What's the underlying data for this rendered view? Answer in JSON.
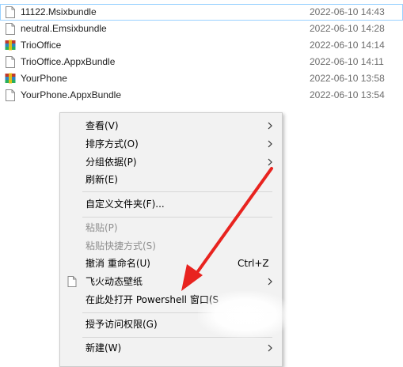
{
  "files": [
    {
      "name": "11122.Msixbundle",
      "date": "2022-06-10 14:43",
      "icon": "blank-file-icon",
      "selected": true
    },
    {
      "name": "neutral.Emsixbundle",
      "date": "2022-06-10 14:28",
      "icon": "blank-file-icon"
    },
    {
      "name": "TrioOffice",
      "date": "2022-06-10 14:14",
      "icon": "archive-icon"
    },
    {
      "name": "TrioOffice.AppxBundle",
      "date": "2022-06-10 14:11",
      "icon": "blank-file-icon"
    },
    {
      "name": "YourPhone",
      "date": "2022-06-10 13:58",
      "icon": "archive-icon"
    },
    {
      "name": "YourPhone.AppxBundle",
      "date": "2022-06-10 13:54",
      "icon": "blank-file-icon"
    }
  ],
  "context_menu": {
    "view": "查看(V)",
    "sort_by": "排序方式(O)",
    "group_by": "分组依据(P)",
    "refresh": "刷新(E)",
    "customize_folder": "自定义文件夹(F)...",
    "paste": "粘贴(P)",
    "paste_shortcut": "粘贴快捷方式(S)",
    "undo_rename": "撤消 重命名(U)",
    "undo_shortcut": "Ctrl+Z",
    "feihuo_wallpaper": "飞火动态壁纸",
    "open_powershell": "在此处打开 Powershell 窗口(S",
    "grant_access": "授予访问权限(G)",
    "new": "新建(W)"
  },
  "colors": {
    "menu_background": "#f2f2f2",
    "arrow": "#e8231f",
    "selection_border": "#99d1ff",
    "date_text": "#6d6d6d",
    "disabled_text": "#8f8f8f"
  }
}
